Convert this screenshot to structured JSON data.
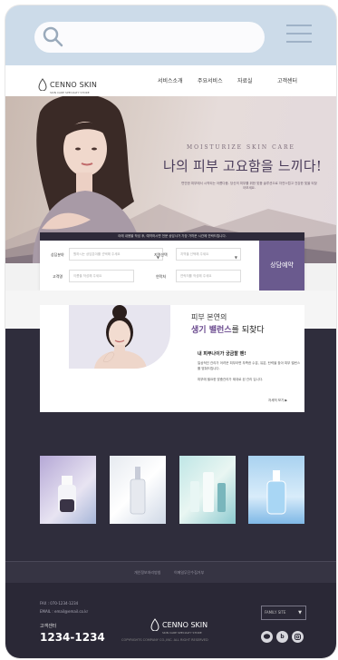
{
  "search": {
    "placeholder": ""
  },
  "site": {
    "logo_text": "CENNO SKIN",
    "logo_sub": "SKIN CARE SPECIALTY STORE"
  },
  "nav": {
    "items": [
      "서비스소개",
      "주요서비스",
      "자료실",
      "고객센터"
    ]
  },
  "hero": {
    "kicker": "MOISTURIZE SKIN CARE",
    "title": "나의 피부 고요함을 느끼다!",
    "desc": "편안한 피부에서 시작되는 아름다움. 당신의 피부를 위한 맞춤 솔루션으로 자연스럽고 건강한 빛을 되찾아보세요."
  },
  "consult": {
    "header": "아래 내용을 작성 후, 예약하시면 전문 상담사가 가장 가까운 시간에 연락드립니다.",
    "fields": [
      {
        "label": "상담분야",
        "placeholder": "원하시는 상담분야를 선택해 주세요",
        "type": "select"
      },
      {
        "label": "지역선택",
        "placeholder": "지역을 선택해 주세요",
        "type": "select"
      },
      {
        "label": "고객명",
        "placeholder": "이름을 작성해 주세요",
        "type": "text"
      },
      {
        "label": "연락처",
        "placeholder": "연락처를 작성해 주세요",
        "type": "text"
      }
    ],
    "button": "상담예약"
  },
  "balance": {
    "kicker": "피부 본연의",
    "title_strong": "생기 밸런스",
    "title_rest": "를 되찾다",
    "sub": "내 피부나이가 궁금할 땐!",
    "text": "일상적인 관리가 어려운 피부라면 부족한 수분, 유분, 탄력을 찾아 피부 밸런스를 맞춰드립니다.",
    "text2": "피부에 필요한 맞춤관리가 제대로 된 관리 입니다.",
    "more": "자세히 보기 ▶"
  },
  "products": [
    {
      "name": "serum-bottle-white"
    },
    {
      "name": "dropper-bottle-clear"
    },
    {
      "name": "ampoule-set-mint"
    },
    {
      "name": "dropper-bottle-blue"
    }
  ],
  "footer": {
    "links": [
      "개인정보처리방침",
      "이메일무단수집거부"
    ],
    "fax": "FAX : 070-1234-1234",
    "email": "EMAIL : email@email.co.kr",
    "cs_label": "고객센터",
    "phone": "1234-1234",
    "logo_text": "CENNO SKIN",
    "logo_sub": "SKIN CARE SPECIALTY STORE",
    "copyright": "COPYRIGHTS COMPANY CO.,INC. ALL RIGHT RESERVED",
    "family_site": "FAMILY SITE",
    "social": [
      "talk",
      "b",
      "instagram"
    ]
  },
  "colors": {
    "topbar": "#ccdbe9",
    "accent": "#6a5a8e",
    "dark_band": "#2f2d3c",
    "footer": "#2a2836"
  }
}
